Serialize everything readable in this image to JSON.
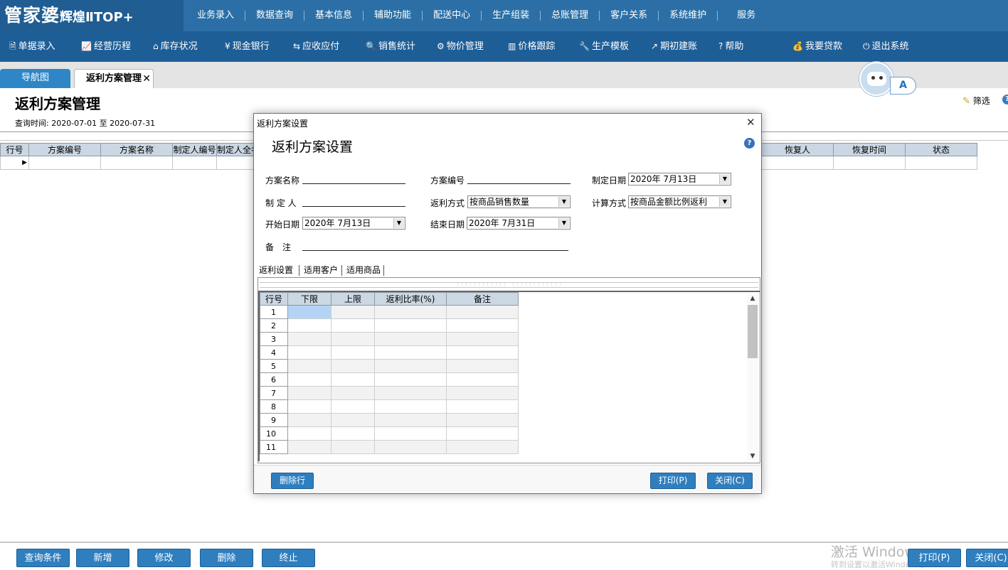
{
  "app": {
    "logo_main": "管家婆",
    "logo_sub": "辉煌ⅡTOP+"
  },
  "top_menu": [
    "业务录入",
    "数据查询",
    "基本信息",
    "辅助功能",
    "配送中心",
    "生产组装",
    "总账管理",
    "客户关系",
    "系统维护",
    "服务"
  ],
  "nav_bar": [
    {
      "label": "单据录入",
      "icon": "document-icon"
    },
    {
      "label": "经营历程",
      "icon": "chart-icon"
    },
    {
      "label": "库存状况",
      "icon": "home-icon"
    },
    {
      "label": "现金银行",
      "icon": "yen-icon"
    },
    {
      "label": "应收应付",
      "icon": "exchange-icon"
    },
    {
      "label": "销售统计",
      "icon": "search-icon"
    },
    {
      "label": "物价管理",
      "icon": "gear-icon"
    },
    {
      "label": "价格跟踪",
      "icon": "bar-chart-icon"
    },
    {
      "label": "生产模板",
      "icon": "wrench-icon"
    },
    {
      "label": "期初建账",
      "icon": "external-icon"
    },
    {
      "label": "帮助",
      "icon": "question-icon"
    },
    {
      "label": "我要贷款",
      "icon": "money-bag-icon"
    },
    {
      "label": "退出系统",
      "icon": "power-icon"
    }
  ],
  "tabs": {
    "nav": "导航图",
    "active": "返利方案管理"
  },
  "avatar_badge": "A",
  "page": {
    "title": "返利方案管理",
    "query_label": "查询时间:",
    "date_from": "2020-07-01",
    "to_label": "至",
    "date_to": "2020-07-31",
    "filter": "筛选"
  },
  "main_grid": {
    "left_headers": [
      "行号",
      "方案编号",
      "方案名称",
      "制定人编号",
      "制定人全名"
    ],
    "right_headers": [
      "恢复人",
      "恢复时间",
      "状态"
    ]
  },
  "bottom_buttons": [
    "查询条件",
    "新增",
    "修改",
    "删除",
    "终止"
  ],
  "bottom_right_buttons": [
    "打印(P)",
    "关闭(C)"
  ],
  "watermark": {
    "line1": "激活 Windows",
    "line2": "转到设置以激活Windows。"
  },
  "dialog": {
    "caption": "返利方案设置",
    "title": "返利方案设置",
    "fields": {
      "scheme_name": "方案名称",
      "scheme_no": "方案编号",
      "made_date": "制定日期",
      "made_date_value": "2020年 7月13日",
      "maker": "制 定 人",
      "rebate_mode": "返利方式",
      "rebate_mode_value": "按商品销售数量",
      "calc_mode": "计算方式",
      "calc_mode_value": "按商品金额比例返利",
      "start_date": "开始日期",
      "start_date_value": "2020年 7月13日",
      "end_date": "结束日期",
      "end_date_value": "2020年 7月31日",
      "remark": "备　注"
    },
    "inner_tabs": [
      "返利设置",
      "适用客户",
      "适用商品"
    ],
    "grid_headers": [
      "行号",
      "下限",
      "上限",
      "返利比率(%)",
      "备注"
    ],
    "rows": [
      "1",
      "2",
      "3",
      "4",
      "5",
      "6",
      "7",
      "8",
      "9",
      "10",
      "11"
    ],
    "delete_row": "删除行",
    "print": "打印(P)",
    "close": "关闭(C)"
  }
}
